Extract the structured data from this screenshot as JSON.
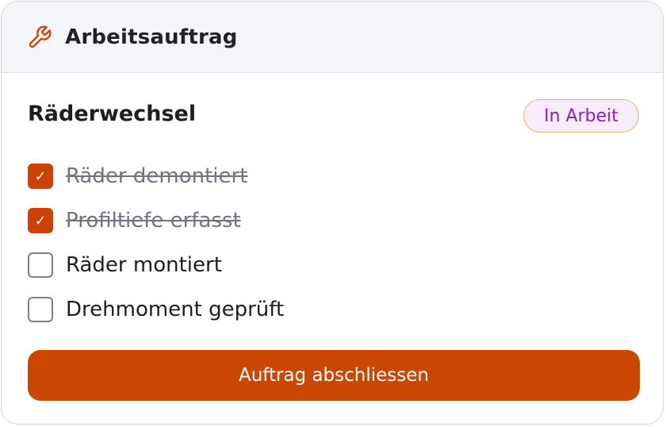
{
  "header": {
    "icon": "wrench-icon",
    "title": "Arbeitsauftrag"
  },
  "task": {
    "title": "Räderwechsel",
    "status": "In Arbeit"
  },
  "checklist": [
    {
      "label": "Räder demontiert",
      "checked": true
    },
    {
      "label": "Profiltiefe erfasst",
      "checked": true
    },
    {
      "label": "Räder montiert",
      "checked": false
    },
    {
      "label": "Drehmoment geprüft",
      "checked": false
    }
  ],
  "checkmark": "✓",
  "actions": {
    "submit_label": "Auftrag abschliessen"
  },
  "colors": {
    "accent": "#cc4604",
    "status_text": "#8a1fc4",
    "status_bg": "#f8ecfb",
    "status_border": "#e8b86a"
  }
}
